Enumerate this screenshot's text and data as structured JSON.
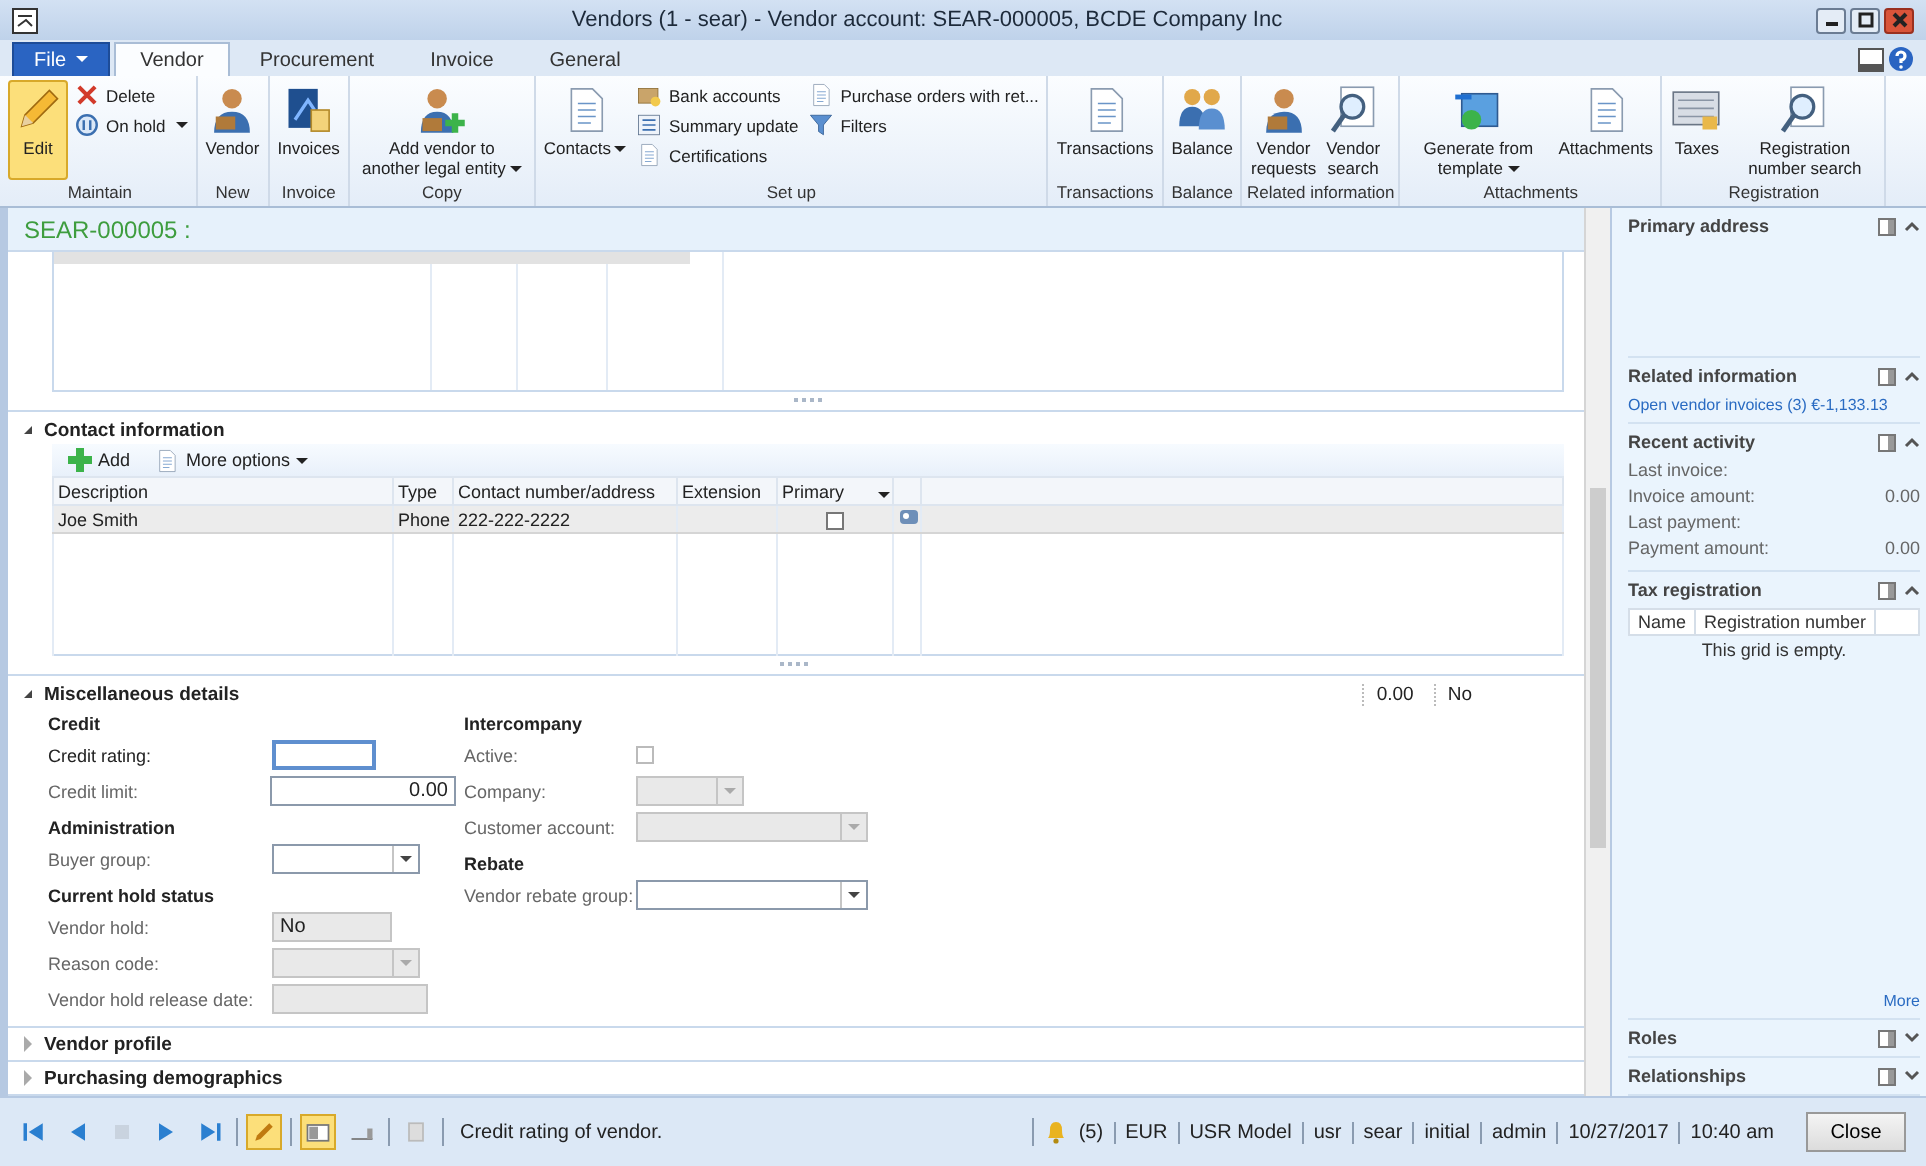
{
  "window": {
    "title": "Vendors (1 - sear) - Vendor account: SEAR-000005, BCDE Company Inc"
  },
  "tabs": [
    {
      "label": "File",
      "kind": "file",
      "selected": false
    },
    {
      "label": "Vendor",
      "kind": "tab",
      "selected": true
    },
    {
      "label": "Procurement",
      "kind": "tab",
      "selected": false
    },
    {
      "label": "Invoice",
      "kind": "tab",
      "selected": false
    },
    {
      "label": "General",
      "kind": "tab",
      "selected": false
    }
  ],
  "ribbon": {
    "groups": [
      {
        "label": "Maintain",
        "buttons": [
          {
            "label": "Edit",
            "kind": "large",
            "selected": true,
            "dropdown": false
          },
          {
            "label": "Delete",
            "kind": "small",
            "selected": false,
            "dropdown": false
          },
          {
            "label": "On hold",
            "kind": "small",
            "selected": false,
            "dropdown": true
          }
        ]
      },
      {
        "label": "New",
        "buttons": [
          {
            "label": "Vendor",
            "kind": "large",
            "selected": false,
            "dropdown": false
          }
        ]
      },
      {
        "label": "Invoice",
        "buttons": [
          {
            "label": "Invoices",
            "kind": "large",
            "selected": false,
            "dropdown": false
          }
        ]
      },
      {
        "label": "Copy",
        "buttons": [
          {
            "label": "Add vendor to another legal entity",
            "kind": "large",
            "selected": false,
            "dropdown": true
          }
        ]
      },
      {
        "label": "Set up",
        "buttons": [
          {
            "label": "Contacts",
            "kind": "large",
            "selected": false,
            "dropdown": true
          },
          {
            "label": "Bank accounts",
            "kind": "small",
            "selected": false,
            "dropdown": false
          },
          {
            "label": "Summary update",
            "kind": "small",
            "selected": false,
            "dropdown": false
          },
          {
            "label": "Certifications",
            "kind": "small",
            "selected": false,
            "dropdown": false
          },
          {
            "label": "Purchase orders with ret...",
            "kind": "small",
            "selected": false,
            "dropdown": false
          },
          {
            "label": "Filters",
            "kind": "small",
            "selected": false,
            "dropdown": false
          }
        ]
      },
      {
        "label": "Transactions",
        "buttons": [
          {
            "label": "Transactions",
            "kind": "large",
            "selected": false,
            "dropdown": false
          }
        ]
      },
      {
        "label": "Balance",
        "buttons": [
          {
            "label": "Balance",
            "kind": "large",
            "selected": false,
            "dropdown": false
          }
        ]
      },
      {
        "label": "Related information",
        "buttons": [
          {
            "label": "Vendor requests",
            "kind": "large",
            "selected": false,
            "dropdown": false
          },
          {
            "label": "Vendor search",
            "kind": "large",
            "selected": false,
            "dropdown": false
          }
        ]
      },
      {
        "label": "Attachments",
        "buttons": [
          {
            "label": "Generate from template",
            "kind": "large",
            "selected": false,
            "dropdown": true
          },
          {
            "label": "Attachments",
            "kind": "large",
            "selected": false,
            "dropdown": false
          }
        ]
      },
      {
        "label": "Registration",
        "buttons": [
          {
            "label": "Taxes",
            "kind": "large",
            "selected": false,
            "dropdown": false
          },
          {
            "label": "Registration number search",
            "kind": "large",
            "selected": false,
            "dropdown": false
          }
        ]
      }
    ]
  },
  "form": {
    "header": "SEAR-000005 :",
    "contact": {
      "title": "Contact information",
      "expanded": true,
      "toolbar": [
        {
          "label": "Add",
          "dropdown": false
        },
        {
          "label": "More options",
          "dropdown": true
        }
      ],
      "columns": [
        "Description",
        "Type",
        "Contact number/address",
        "Extension",
        "Primary"
      ],
      "rows": [
        {
          "cells": [
            "Joe Smith",
            "Phone",
            "222-222-2222",
            null
          ],
          "primary": false,
          "selected": true
        }
      ]
    },
    "misc": {
      "title": "Miscellaneous details",
      "expanded": true,
      "summary": [
        "0.00",
        "No"
      ],
      "columns": [
        [
          {
            "kind": "heading",
            "text": "Credit"
          },
          {
            "kind": "text",
            "label": "Credit rating:",
            "focused": true,
            "disabled": false
          },
          {
            "kind": "text",
            "label": "Credit limit:",
            "value": "0.00",
            "focused": false,
            "disabled": false
          },
          {
            "kind": "heading",
            "text": "Administration"
          },
          {
            "kind": "combo",
            "label": "Buyer group:",
            "focused": false,
            "disabled": false
          },
          {
            "kind": "heading",
            "text": "Current hold status"
          },
          {
            "kind": "text",
            "label": "Vendor hold:",
            "value": "No",
            "focused": false,
            "disabled": true
          },
          {
            "kind": "combo",
            "label": "Reason code:",
            "focused": false,
            "disabled": true
          },
          {
            "kind": "text",
            "label": "Vendor hold release date:",
            "focused": false,
            "disabled": true
          }
        ],
        [
          {
            "kind": "heading",
            "text": "Intercompany"
          },
          {
            "kind": "checkbox",
            "label": "Active:",
            "checked": false,
            "focused": false,
            "disabled": true
          },
          {
            "kind": "combo",
            "label": "Company:",
            "focused": false,
            "disabled": true
          },
          {
            "kind": "combo",
            "label": "Customer account:",
            "focused": false,
            "disabled": true
          },
          {
            "kind": "heading",
            "text": "Rebate"
          },
          {
            "kind": "combo",
            "label": "Vendor rebate group:",
            "focused": false,
            "disabled": false
          }
        ]
      ]
    },
    "collapsed_sections": [
      {
        "title": "Vendor profile",
        "expanded": false
      },
      {
        "title": "Purchasing demographics",
        "expanded": false
      }
    ]
  },
  "factbox": [
    {
      "title": "Primary address",
      "expanded": true,
      "kind": "empty"
    },
    {
      "title": "Related information",
      "expanded": true,
      "kind": "links",
      "links": [
        "Open vendor invoices (3) €-1,133.13"
      ]
    },
    {
      "title": "Recent activity",
      "expanded": true,
      "kind": "fields",
      "fields": [
        {
          "label": "Last invoice:"
        },
        {
          "label": "Invoice amount:",
          "value": "0.00"
        },
        {
          "label": "Last payment:"
        },
        {
          "label": "Payment amount:",
          "value": "0.00"
        }
      ]
    },
    {
      "title": "Tax registration",
      "expanded": true,
      "kind": "grid",
      "columns": [
        "Name",
        "Registration number"
      ],
      "empty_text": "This grid is empty.",
      "more": "More"
    },
    {
      "title": "Roles",
      "expanded": false,
      "kind": "empty"
    },
    {
      "title": "Relationships",
      "expanded": false,
      "kind": "empty"
    }
  ],
  "status_bar": {
    "tools": [
      {
        "kind": "first",
        "selected": false
      },
      {
        "kind": "prev",
        "selected": false
      },
      {
        "kind": "grid",
        "selected": false
      },
      {
        "kind": "next",
        "selected": false
      },
      {
        "kind": "last",
        "selected": false
      },
      {
        "kind": "edit",
        "selected": true
      },
      {
        "kind": "form",
        "selected": true
      },
      {
        "kind": "list",
        "selected": false
      },
      {
        "kind": "paste",
        "selected": false
      }
    ],
    "message": "Credit rating of vendor.",
    "alerts": "(5)",
    "fields": [
      "EUR",
      "USR Model",
      "usr",
      "sear",
      "initial",
      "admin",
      "10/27/2017",
      "10:40 am"
    ],
    "close": "Close"
  }
}
